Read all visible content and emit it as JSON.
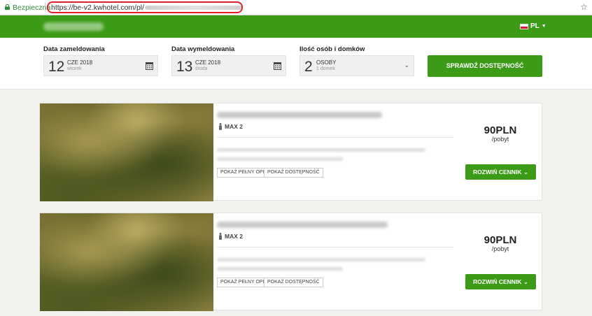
{
  "browser": {
    "secure_label": "Bezpieczna",
    "url_prefix": "https://be-v2.kwhotel.com/pl/",
    "url_suffix": "/0"
  },
  "nav": {
    "language": "PL"
  },
  "search": {
    "checkin_label": "Data zameldowania",
    "checkin_day": "12",
    "checkin_month": "CZE 2018",
    "checkin_weekday": "wtorek",
    "checkout_label": "Data wymeldowania",
    "checkout_day": "13",
    "checkout_month": "CZE 2018",
    "checkout_weekday": "środa",
    "guests_label": "Ilość osób i domków",
    "guests_count": "2",
    "guests_unit": "OSOBY",
    "guests_houses": "1 domek",
    "check_button": "SPRAWDŹ DOSTĘPNOŚĆ"
  },
  "rooms": [
    {
      "max": "MAX 2",
      "full_desc_button": "POKAŻ PEŁNY OPIS",
      "availability_button": "POKAŻ DOSTĘPNOŚĆ",
      "price": "90PLN",
      "per": "/pobyt",
      "expand_button": "ROZWIŃ CENNIK"
    },
    {
      "max": "MAX 2",
      "full_desc_button": "POKAŻ PEŁNY OPIS",
      "availability_button": "POKAŻ DOSTĘPNOŚĆ",
      "price": "90PLN",
      "per": "/pobyt",
      "expand_button": "ROZWIŃ CENNIK"
    }
  ],
  "colors": {
    "brand_green": "#3b9b16",
    "url_highlight": "#e0202a"
  }
}
